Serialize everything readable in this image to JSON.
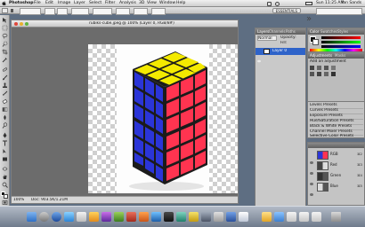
{
  "menubar": {
    "app_name": "Photoshop",
    "items": [
      "File",
      "Edit",
      "Image",
      "Layer",
      "Select",
      "Filter",
      "Analysis",
      "3D",
      "View",
      "Window",
      "Help"
    ],
    "clock": "Sun 11:25 AM",
    "user": "Ian Sands"
  },
  "options_bar": {
    "essentials_label": "ESSENTIALS"
  },
  "document": {
    "title": "rubiks-cube.jpeg @ 100% (Layer 0, RGB/8#)",
    "zoom": "100%",
    "status": "Doc: 903.5K/1.21M"
  },
  "layers_panel": {
    "tabs": [
      "Layers",
      "Channels",
      "Paths"
    ],
    "blend_mode": "Normal",
    "opacity_label": "Opacity:",
    "fill_label": "Fill:",
    "layer_name": "Layer 0"
  },
  "color_panel": {
    "tabs": [
      "Color",
      "Swatches",
      "Styles"
    ]
  },
  "adjustments_panel": {
    "tabs": [
      "Adjustments",
      "Masks"
    ],
    "heading": "Add an adjustment",
    "presets": [
      "Levels Presets",
      "Curves Presets",
      "Exposure Presets",
      "Hue/Saturation Presets",
      "Black & White Presets",
      "Channel Mixer Presets",
      "Selective Color Presets"
    ]
  },
  "channels_panel": {
    "rows": [
      {
        "name": "RGB",
        "key": "⌘2"
      },
      {
        "name": "Red",
        "key": "⌘3"
      },
      {
        "name": "Green",
        "key": "⌘4"
      },
      {
        "name": "Blue",
        "key": "⌘5"
      }
    ]
  },
  "colors": {
    "cube_yellow": "#f4ea00",
    "cube_red": "#ff3450",
    "cube_blue": "#2b35d8",
    "selection_blue": "#2e63c9"
  }
}
